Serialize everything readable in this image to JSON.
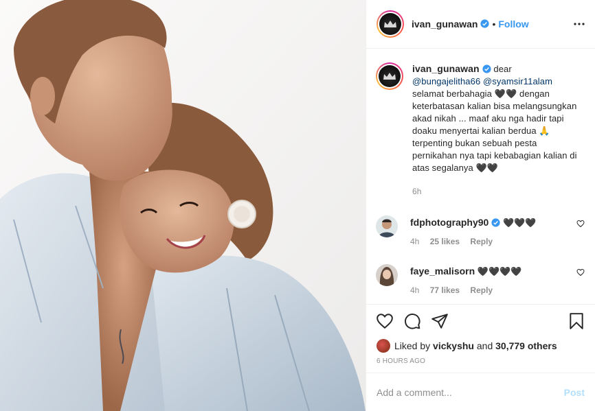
{
  "post": {
    "username": "ivan_gunawan",
    "follow_label": "Follow",
    "separator": "•"
  },
  "caption": {
    "username": "ivan_gunawan",
    "lead": "dear",
    "mention1": "@bungajelitha66",
    "mention2": "@syamsir11alam",
    "text": "selamat berbahagia 🖤🖤 dengan keterbatasan kalian bisa melangsungkan akad nikah ... maaf aku nga hadir tapi doaku menyertai kalian berdua 🙏 terpenting bukan sebuah pesta pernikahan nya tapi kebabagian kalian di atas segalanya 🖤🖤",
    "time": "6h"
  },
  "comments": [
    {
      "username": "fdphotography90",
      "text": "🖤🖤🖤",
      "time": "4h",
      "likes": "25 likes",
      "reply": "Reply",
      "verified": true
    },
    {
      "username": "faye_malisorn",
      "text": "🖤🖤🖤🖤",
      "time": "4h",
      "likes": "77 likes",
      "reply": "Reply",
      "verified": false
    }
  ],
  "likes": {
    "prefix": "Liked by",
    "user": "vickyshu",
    "mid": "and",
    "count": "30,779 others"
  },
  "timestamp": "6 HOURS AGO",
  "add_comment": {
    "placeholder": "Add a comment...",
    "post_label": "Post"
  },
  "colors": {
    "link": "#3897f0",
    "mention": "#003569",
    "muted": "#8e8e8e",
    "post_disabled": "#b2dffc"
  }
}
